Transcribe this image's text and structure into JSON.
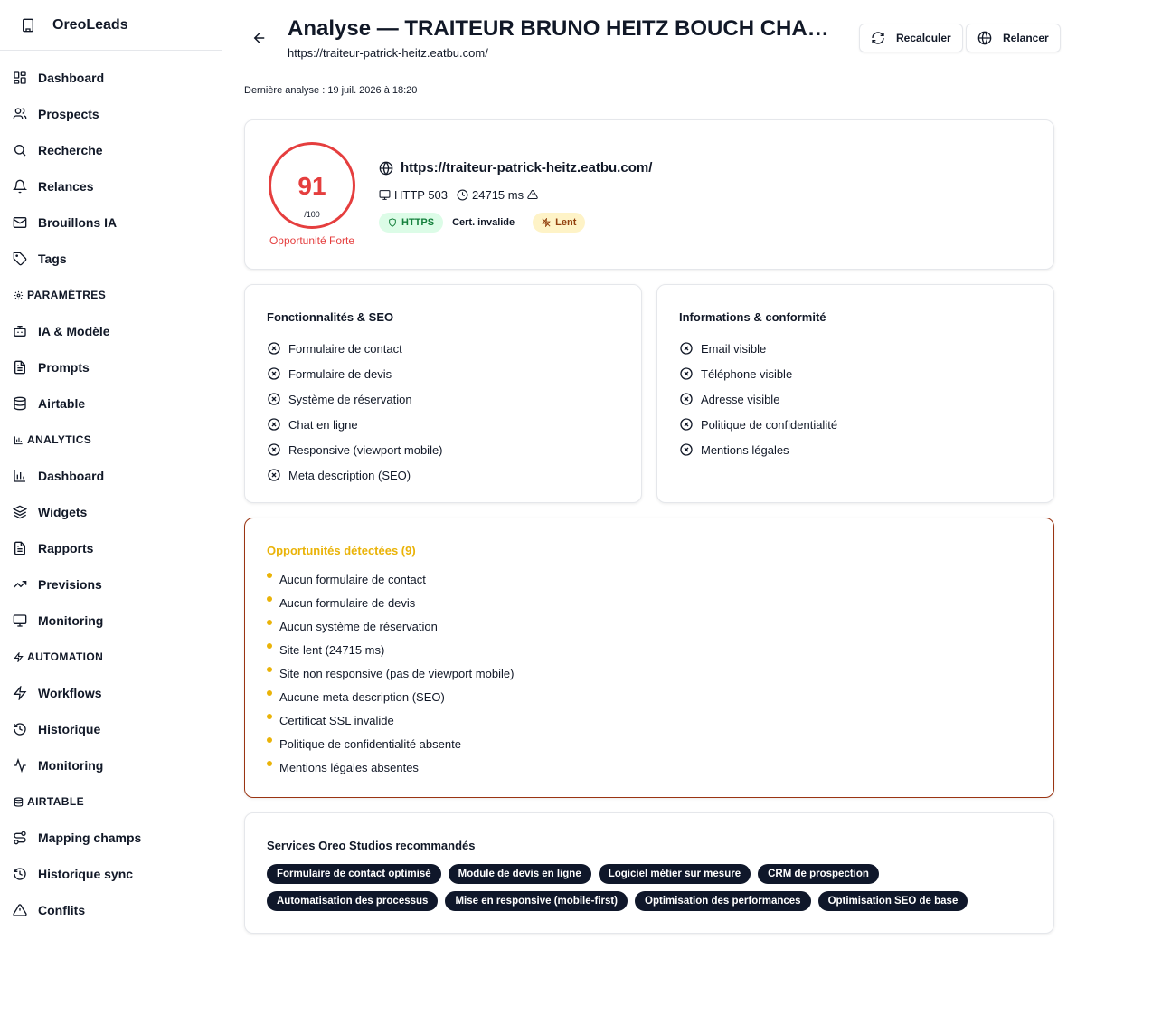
{
  "app": {
    "name": "OreoLeads"
  },
  "sidebar": {
    "items_main": [
      {
        "label": "Dashboard"
      },
      {
        "label": "Prospects"
      },
      {
        "label": "Recherche"
      },
      {
        "label": "Relances"
      },
      {
        "label": "Brouillons IA"
      },
      {
        "label": "Tags"
      }
    ],
    "section_params": "PARAMÈTRES",
    "items_params": [
      {
        "label": "IA & Modèle"
      },
      {
        "label": "Prompts"
      },
      {
        "label": "Airtable"
      }
    ],
    "section_analytics": "ANALYTICS",
    "items_analytics": [
      {
        "label": "Dashboard"
      },
      {
        "label": "Widgets"
      },
      {
        "label": "Rapports"
      },
      {
        "label": "Previsions"
      },
      {
        "label": "Monitoring"
      }
    ],
    "section_automation": "AUTOMATION",
    "items_automation": [
      {
        "label": "Workflows"
      },
      {
        "label": "Historique"
      },
      {
        "label": "Monitoring"
      }
    ],
    "section_airtable": "AIRTABLE",
    "items_airtable": [
      {
        "label": "Mapping champs"
      },
      {
        "label": "Historique sync"
      },
      {
        "label": "Conflits"
      }
    ]
  },
  "header": {
    "title": "Analyse — TRAITEUR BRUNO HEITZ BOUCH CHARCUTERIE",
    "subtitle": "https://traiteur-patrick-heitz.eatbu.com/",
    "recalc_label": "Recalculer",
    "relancer_label": "Relancer",
    "last_run": "Dernière analyse : 19 juil. 2026 à 18:20"
  },
  "score": {
    "value": "91",
    "max": "/100",
    "label": "Opportunité Forte",
    "url": "https://traiteur-patrick-heitz.eatbu.com/",
    "http": "HTTP 503",
    "time": "24715 ms",
    "badge_https": "HTTPS",
    "badge_cert": "Cert. invalide",
    "badge_slow": "Lent"
  },
  "features": {
    "title": "Fonctionnalités & SEO",
    "items": [
      "Formulaire de contact",
      "Formulaire de devis",
      "Système de réservation",
      "Chat en ligne",
      "Responsive (viewport mobile)",
      "Meta description (SEO)"
    ]
  },
  "info": {
    "title": "Informations & conformité",
    "items": [
      "Email visible",
      "Téléphone visible",
      "Adresse visible",
      "Politique de confidentialité",
      "Mentions légales"
    ]
  },
  "opportunities": {
    "title": "Opportunités détectées (9)",
    "items": [
      "Aucun formulaire de contact",
      "Aucun formulaire de devis",
      "Aucun système de réservation",
      "Site lent (24715 ms)",
      "Site non responsive (pas de viewport mobile)",
      "Aucune meta description (SEO)",
      "Certificat SSL invalide",
      "Politique de confidentialité absente",
      "Mentions légales absentes"
    ]
  },
  "services": {
    "title": "Services Oreo Studios recommandés",
    "items": [
      "Formulaire de contact optimisé",
      "Module de devis en ligne",
      "Logiciel métier sur mesure",
      "CRM de prospection",
      "Automatisation des processus",
      "Mise en responsive (mobile-first)",
      "Optimisation des performances",
      "Optimisation SEO de base"
    ]
  },
  "colors": {
    "danger": "#e53e3e",
    "warning": "#eab308",
    "chip_bg": "#0f172a"
  }
}
